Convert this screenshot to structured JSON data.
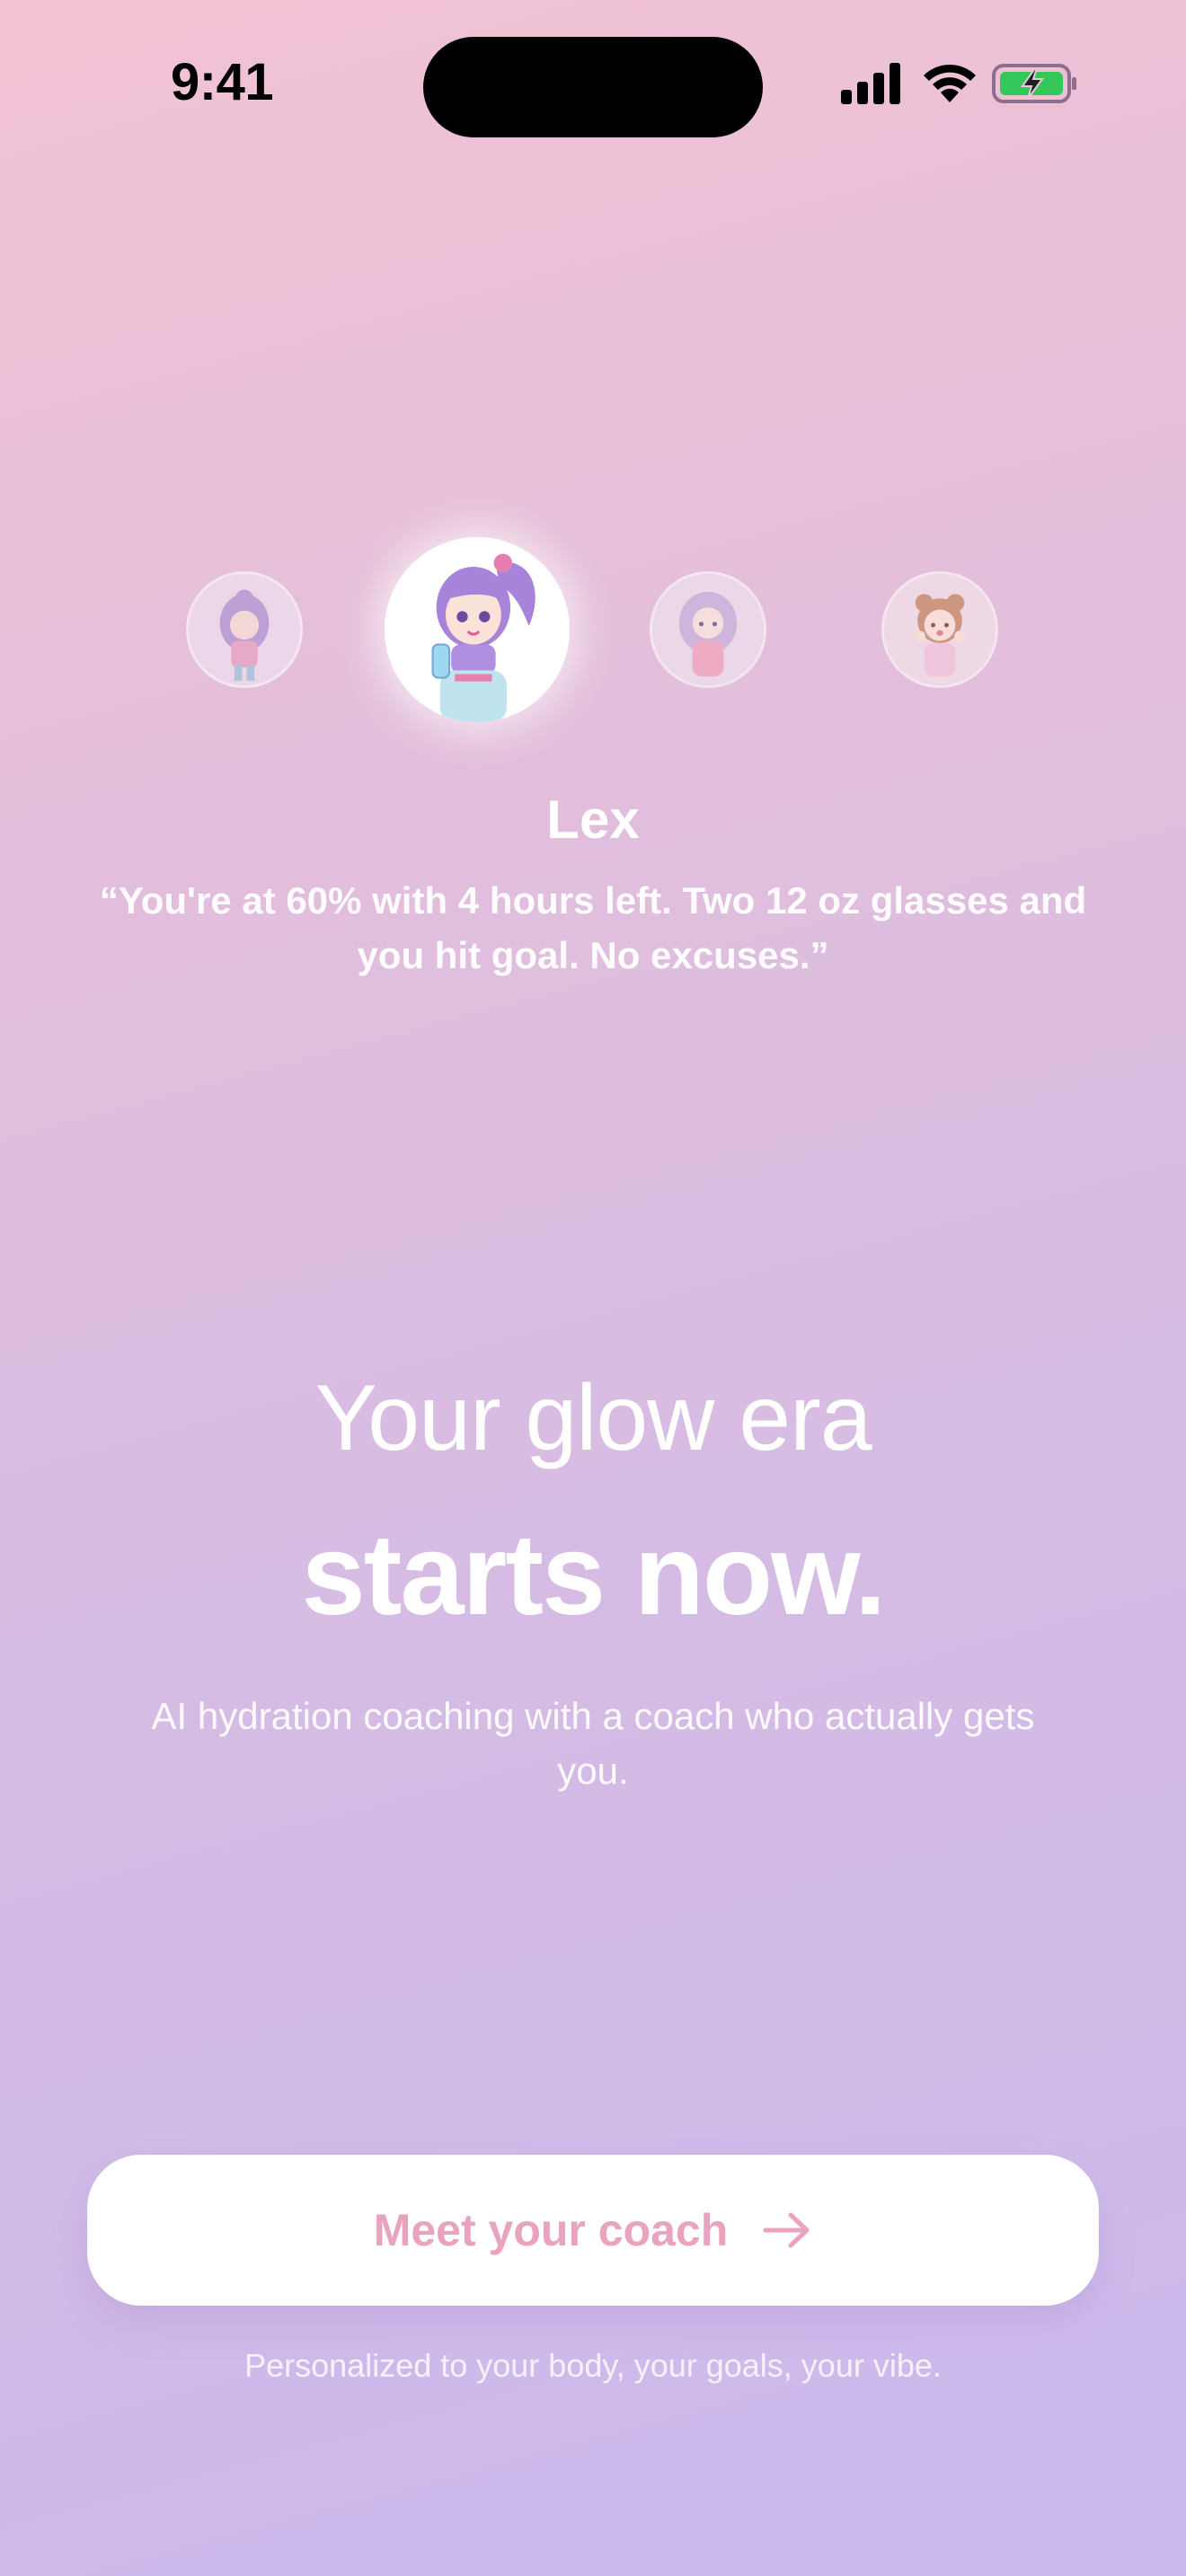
{
  "status_bar": {
    "time": "9:41",
    "icons": [
      "cellular-signal-icon",
      "wifi-icon",
      "battery-charging-icon"
    ],
    "battery_color": "#34c759"
  },
  "coaches": [
    {
      "name": "coach-1",
      "selected": false
    },
    {
      "name": "Lex",
      "selected": true
    },
    {
      "name": "coach-3",
      "selected": false
    },
    {
      "name": "coach-4",
      "selected": false
    }
  ],
  "selected_coach": {
    "name": "Lex",
    "quote": "“You're at 60% with 4 hours left. Two 12 oz glasses and you hit goal. No excuses.”"
  },
  "hero": {
    "line1": "Your glow era",
    "line2": "starts now.",
    "subtext": "AI hydration coaching with a coach who actually gets you."
  },
  "cta": {
    "label": "Meet your coach",
    "icon": "arrow-right-icon",
    "color": "#e9a3bf"
  },
  "footnote": "Personalized to your body, your goals, your vibe.",
  "colors": {
    "background_top": "#f3c2d4",
    "background_bottom": "#cbbaee",
    "accent": "#e9a3bf"
  }
}
